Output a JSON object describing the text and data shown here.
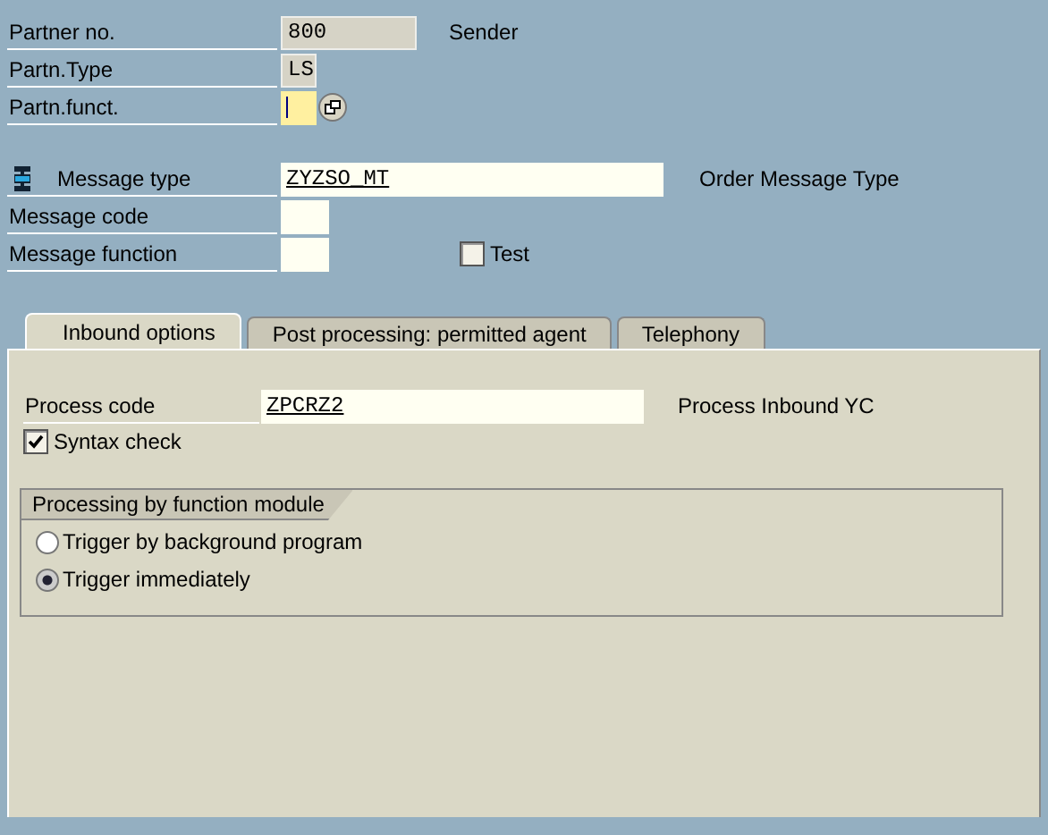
{
  "partner_rows": [
    {
      "label": "Partner no.",
      "value": "800",
      "editable": false,
      "focused": false,
      "underlined": false,
      "description": "Sender"
    },
    {
      "label": "Partn.Type",
      "value": "LS",
      "editable": false,
      "focused": false,
      "underlined": false
    },
    {
      "label": "Partn.funct.",
      "editable": true,
      "focused": true,
      "lookup_button": true
    }
  ],
  "message_rows": [
    {
      "label": "Message type",
      "value": "ZYZSO_MT",
      "editable": true,
      "focused": false,
      "underlined": true,
      "description": "Order Message Type",
      "icon": true
    },
    {
      "label": "Message code",
      "editable": true,
      "focused": false
    },
    {
      "label": "Message function",
      "editable": true,
      "focused": false,
      "checkbox": {
        "label": "Test",
        "checked": false
      }
    }
  ],
  "tabs": [
    {
      "label": "Inbound options",
      "selected": true
    },
    {
      "label": "Post processing: permitted agent",
      "selected": false
    },
    {
      "label": "Telephony",
      "selected": false
    }
  ],
  "inbound": {
    "process_code": {
      "label": "Process code",
      "value": "ZPCRZ2",
      "editable": true,
      "focused": false,
      "underlined": true,
      "description": "Process Inbound YC"
    },
    "syntax_check": {
      "label": "Syntax check",
      "checked": true
    },
    "group": {
      "title": "Processing by function module",
      "options": [
        {
          "label": "Trigger by background program",
          "selected": false
        },
        {
          "label": "Trigger immediately",
          "selected": true
        }
      ]
    }
  }
}
